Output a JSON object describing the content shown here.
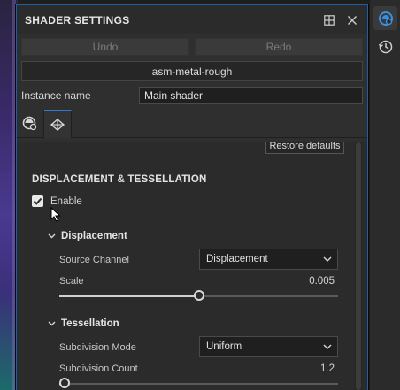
{
  "panel": {
    "title": "SHADER SETTINGS",
    "undo_label": "Undo",
    "redo_label": "Redo",
    "preset_label": "asm-metal-rough",
    "instance_label": "Instance name",
    "instance_value": "Main shader"
  },
  "content": {
    "restore_label": "Restore defaults",
    "section_title": "DISPLACEMENT & TESSELLATION",
    "enable_label": "Enable",
    "enable_checked": true,
    "displacement": {
      "title": "Displacement",
      "source_channel_label": "Source Channel",
      "source_channel_value": "Displacement",
      "scale_label": "Scale",
      "scale_value": "0.005",
      "scale_fraction": 0.5
    },
    "tessellation": {
      "title": "Tessellation",
      "subdivision_mode_label": "Subdivision Mode",
      "subdivision_mode_value": "Uniform",
      "subdivision_count_label": "Subdivision Count",
      "subdivision_count_value": "1.2",
      "subdivision_fraction": 0.02
    }
  },
  "icons": {
    "titlebar": [
      "dock-icon",
      "close-icon"
    ],
    "tabs": [
      "sphere-settings-icon",
      "displacement-tab-icon"
    ],
    "side_bar": [
      "shader-settings-icon",
      "history-icon"
    ]
  },
  "colors": {
    "accent": "#2d7bd0",
    "panel_bg": "#2f2f2f",
    "content_bg": "#2b2b2b"
  }
}
